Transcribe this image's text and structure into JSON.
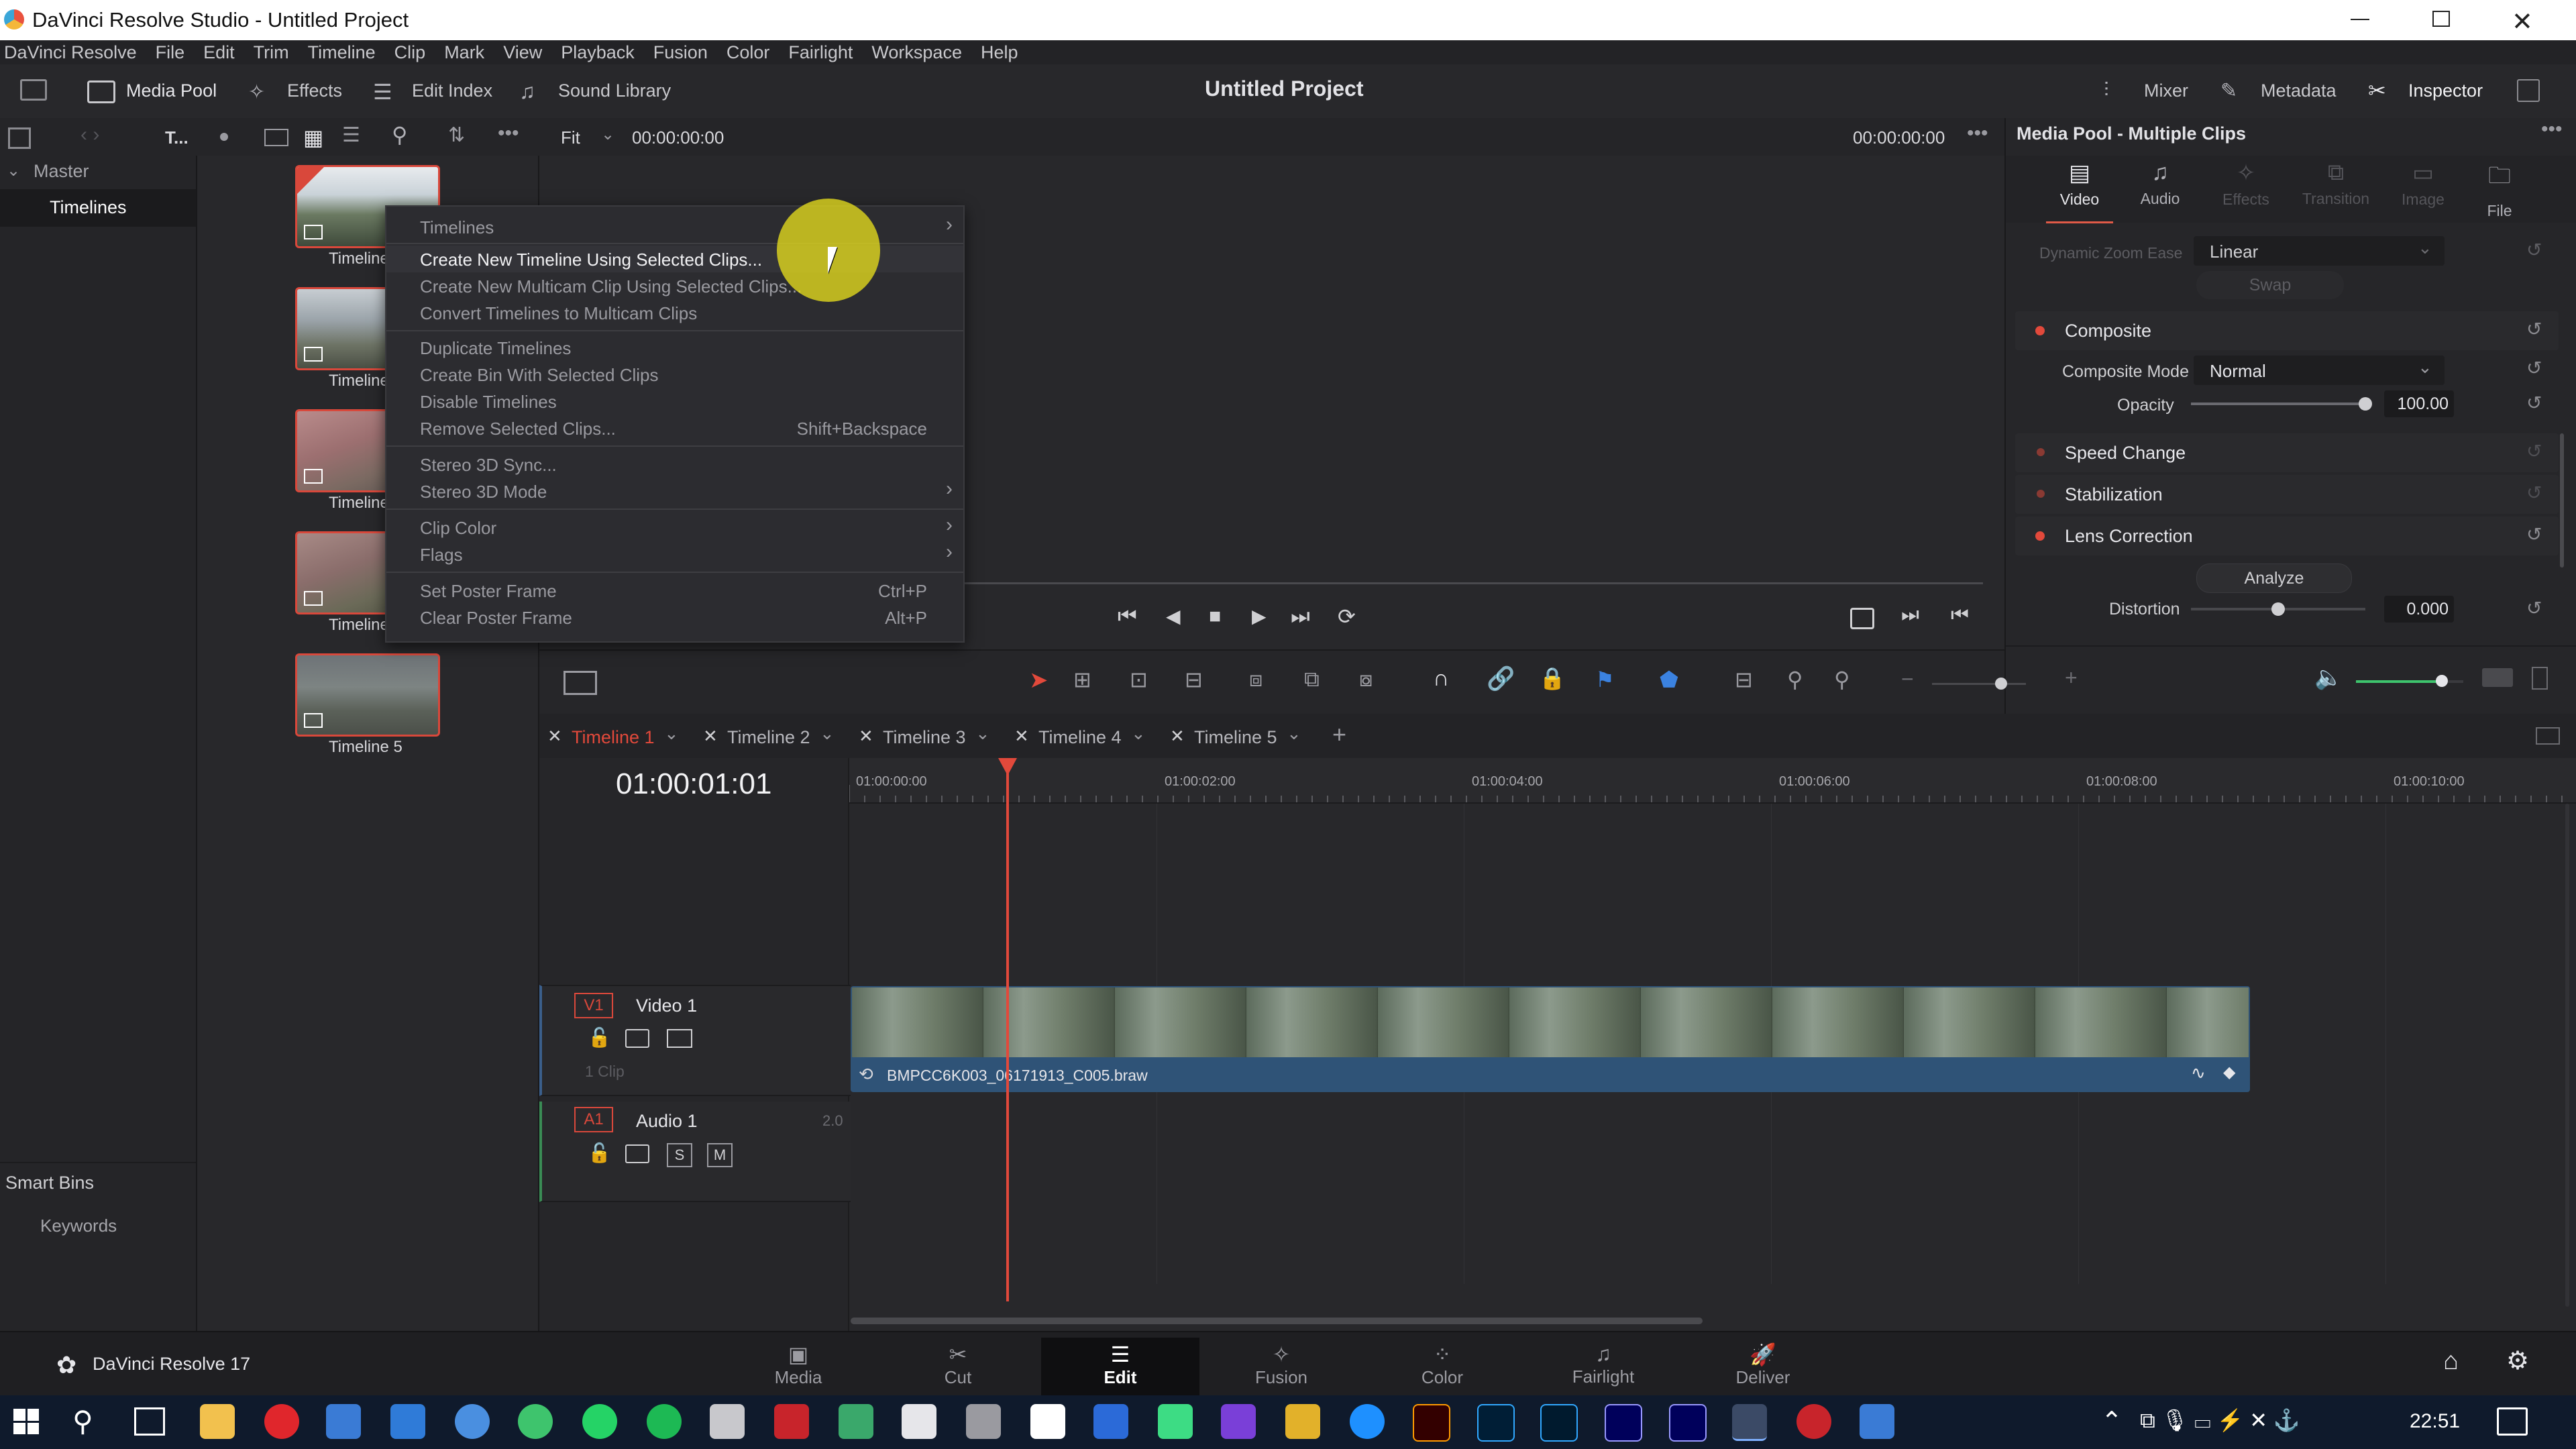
{
  "window": {
    "title": "DaVinci Resolve Studio - Untitled Project",
    "controls": [
      "minimize-icon",
      "restore-icon",
      "close-icon"
    ]
  },
  "menu": [
    "DaVinci Resolve",
    "File",
    "Edit",
    "Trim",
    "Timeline",
    "Clip",
    "Mark",
    "View",
    "Playback",
    "Fusion",
    "Color",
    "Fairlight",
    "Workspace",
    "Help"
  ],
  "toolbar": {
    "media_pool": "Media Pool",
    "effects": "Effects",
    "edit_index": "Edit Index",
    "sound_library": "Sound Library",
    "project_title": "Untitled Project",
    "mixer": "Mixer",
    "metadata": "Metadata",
    "inspector": "Inspector"
  },
  "subbar": {
    "bin_name": "T...",
    "zoom": "Fit",
    "source_timecode": "00:00:00:00",
    "record_timecode": "00:00:00:00"
  },
  "bins": {
    "master": "Master",
    "timelines": "Timelines",
    "smart_bins": "Smart Bins",
    "keywords": "Keywords"
  },
  "thumbnails": [
    {
      "label": "Timeline 1"
    },
    {
      "label": "Timeline 2"
    },
    {
      "label": "Timeline 3"
    },
    {
      "label": "Timeline 4"
    },
    {
      "label": "Timeline 5"
    }
  ],
  "context_menu": {
    "items": [
      {
        "label": "Timelines",
        "submenu": true,
        "shortcut": ""
      },
      {
        "label": "Create New Timeline Using Selected Clips...",
        "highlight": true,
        "shortcut": ""
      },
      {
        "label": "Create New Multicam Clip Using Selected Clips...",
        "shortcut": ""
      },
      {
        "label": "Convert Timelines to Multicam Clips",
        "shortcut": ""
      },
      {
        "label": "Duplicate Timelines",
        "shortcut": ""
      },
      {
        "label": "Create Bin With Selected Clips",
        "shortcut": ""
      },
      {
        "label": "Disable Timelines",
        "shortcut": ""
      },
      {
        "label": "Remove Selected Clips...",
        "shortcut": "Shift+Backspace"
      },
      {
        "label": "Stereo 3D Sync...",
        "shortcut": ""
      },
      {
        "label": "Stereo 3D Mode",
        "submenu": true,
        "shortcut": ""
      },
      {
        "label": "Clip Color",
        "submenu": true,
        "shortcut": ""
      },
      {
        "label": "Flags",
        "submenu": true,
        "shortcut": ""
      },
      {
        "label": "Set Poster Frame",
        "shortcut": "Ctrl+P"
      },
      {
        "label": "Clear Poster Frame",
        "shortcut": "Alt+P"
      }
    ]
  },
  "inspector": {
    "header": "Media Pool - Multiple Clips",
    "tabs": [
      "Video",
      "Audio",
      "Effects",
      "Transition",
      "Image",
      "File"
    ],
    "dynamic_zoom_ease_label": "Dynamic Zoom Ease",
    "dynamic_zoom_ease_value": "Linear",
    "swap": "Swap",
    "composite": "Composite",
    "composite_mode_label": "Composite Mode",
    "composite_mode_value": "Normal",
    "opacity_label": "Opacity",
    "opacity_value": "100.00",
    "opacity_level": 1.0,
    "speed_change": "Speed Change",
    "stabilization": "Stabilization",
    "lens_correction": "Lens Correction",
    "analyze": "Analyze",
    "distortion_label": "Distortion",
    "distortion_value": "0.000",
    "distortion_level": 0.5
  },
  "timeline": {
    "tabs": [
      "Timeline 1",
      "Timeline 2",
      "Timeline 3",
      "Timeline 4",
      "Timeline 5"
    ],
    "active_tab": 0,
    "timecode": "01:00:01:01",
    "ruler": [
      "01:00:00:00",
      "01:00:02:00",
      "01:00:04:00",
      "01:00:06:00",
      "01:00:08:00",
      "01:00:10:00"
    ],
    "video_track": {
      "id": "V1",
      "name": "Video 1",
      "info": "1 Clip"
    },
    "audio_track": {
      "id": "A1",
      "name": "Audio 1",
      "channels": "2.0",
      "solo": "S",
      "mute": "M"
    },
    "clip_name": "BMPCC6K003_06171913_C005.braw",
    "audio_level": 0.8
  },
  "pages": [
    "Media",
    "Cut",
    "Edit",
    "Fusion",
    "Color",
    "Fairlight",
    "Deliver"
  ],
  "active_page": "Edit",
  "app_label": "DaVinci Resolve 17",
  "taskbar": {
    "time": "22:51"
  }
}
